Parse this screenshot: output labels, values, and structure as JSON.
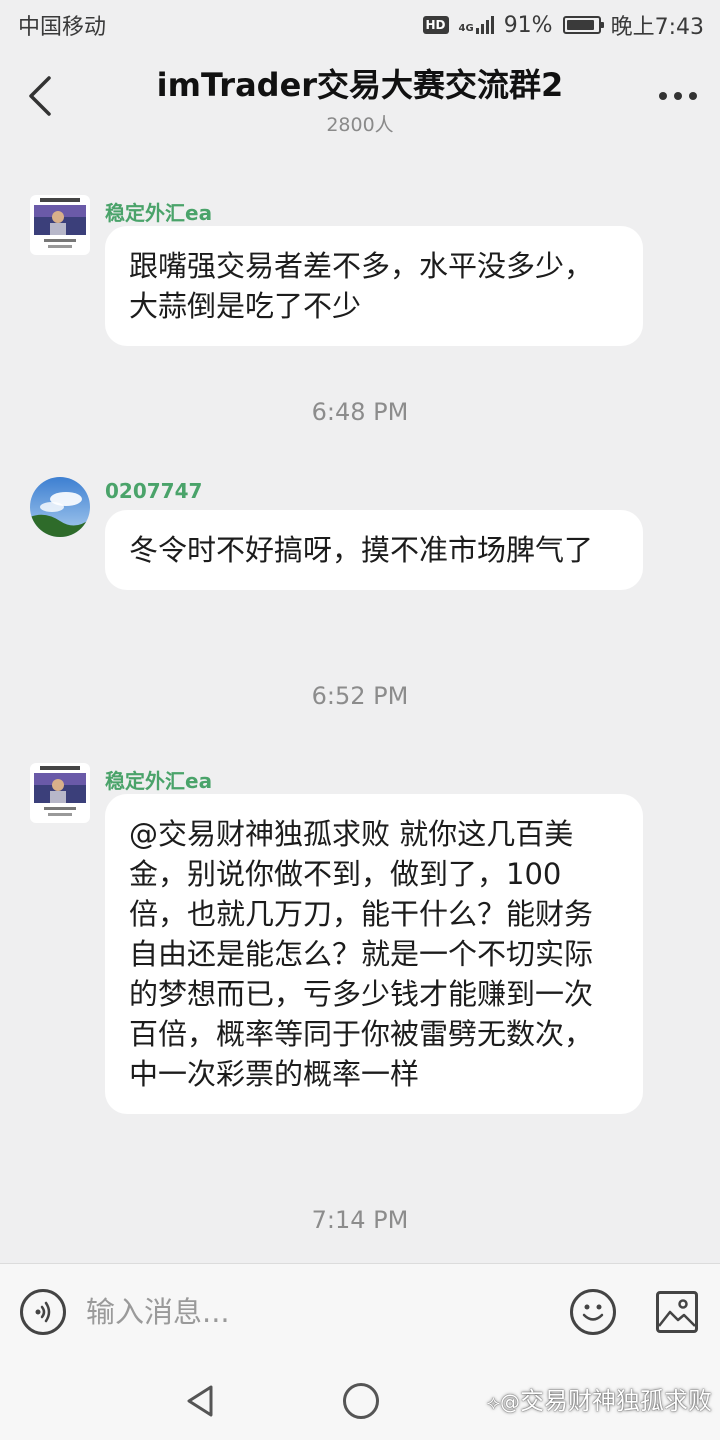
{
  "status_bar": {
    "carrier": "中国移动",
    "hd": "HD",
    "network": "4G",
    "battery": "91%",
    "battery_level": 0.91,
    "time": "晚上7:43"
  },
  "header": {
    "title": "imTrader交易大赛交流群2",
    "member_count": "2800人"
  },
  "messages": [
    {
      "sender": "稳定外汇ea",
      "text": "跟嘴强交易者差不多，水平没多少，大蒜倒是吃了不少"
    },
    {
      "timestamp": "6:48 PM"
    },
    {
      "sender": "0207747",
      "text": "冬令时不好搞呀，摸不准市场脾气了"
    },
    {
      "timestamp": "6:52 PM"
    },
    {
      "sender": "稳定外汇ea",
      "text": "@交易财神独孤求败 就你这几百美金，别说你做不到，做到了，100倍，也就几万刀，能干什么？能财务自由还是能怎么？就是一个不切实际的梦想而已，亏多少钱才能赚到一次百倍，概率等同于你被雷劈无数次，中一次彩票的概率一样"
    },
    {
      "timestamp": "7:14 PM"
    }
  ],
  "input_bar": {
    "placeholder": "输入消息..."
  },
  "watermark": "交易财神独孤求败",
  "colors": {
    "sender_name": "#4aa36a",
    "background": "#efeff0",
    "bubble": "#ffffff"
  },
  "icons": [
    "back-arrow-icon",
    "more-dots-icon",
    "voice-icon",
    "emoji-icon",
    "image-icon",
    "nav-back-icon",
    "nav-home-icon"
  ]
}
